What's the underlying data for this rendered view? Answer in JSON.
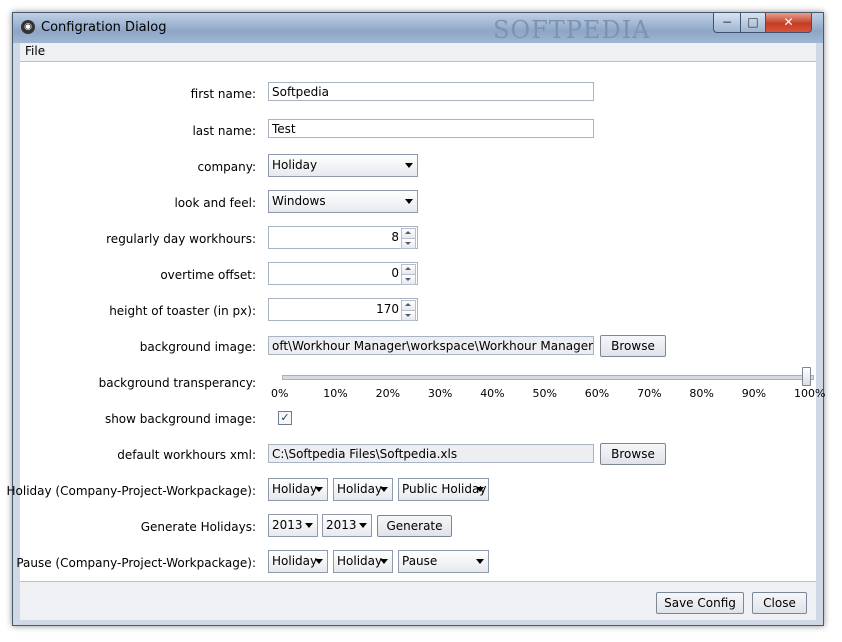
{
  "window": {
    "title": "Configration Dialog",
    "watermark": "SOFTPEDIA",
    "app_icon": "app-logo-icon"
  },
  "menu": {
    "file": "File"
  },
  "form": {
    "first_name": {
      "label": "first name:",
      "value": "Softpedia"
    },
    "last_name": {
      "label": "last name:",
      "value": "Test"
    },
    "company": {
      "label": "company:",
      "value": "Holiday"
    },
    "look_and_feel": {
      "label": "look and feel:",
      "value": "Windows"
    },
    "day_workhours": {
      "label": "regularly day workhours:",
      "value": "8"
    },
    "overtime_offset": {
      "label": "overtime offset:",
      "value": "0"
    },
    "toaster_height": {
      "label": "height of toaster (in px):",
      "value": "170"
    },
    "background_image": {
      "label": "background image:",
      "value": "oft\\Workhour Manager\\workspace\\Workhour Manager\\splash.png",
      "button": "Browse"
    },
    "transparency": {
      "label": "background transperancy:",
      "value": 1.0,
      "ticks": [
        "0%",
        "10%",
        "20%",
        "30%",
        "40%",
        "50%",
        "60%",
        "70%",
        "80%",
        "90%",
        "100%"
      ]
    },
    "show_background": {
      "label": "show background image:",
      "checked": true,
      "check_mark": "✓"
    },
    "default_xml": {
      "label": "default workhours xml:",
      "value": "C:\\Softpedia Files\\Softpedia.xls",
      "button": "Browse"
    },
    "holiday": {
      "label": "Holiday (Company-Project-Workpackage):",
      "company": "Holiday",
      "project": "Holiday",
      "workpackage": "Public Holiday"
    },
    "generate": {
      "label": "Generate Holidays:",
      "from": "2013",
      "to": "2013",
      "button": "Generate"
    },
    "pause": {
      "label": "Pause (Company-Project-Workpackage):",
      "company": "Holiday",
      "project": "Holiday",
      "workpackage": "Pause"
    }
  },
  "footer": {
    "save": "Save Config",
    "close": "Close"
  },
  "controls": {
    "minimize": "−",
    "maximize": "□",
    "close": "✕"
  }
}
